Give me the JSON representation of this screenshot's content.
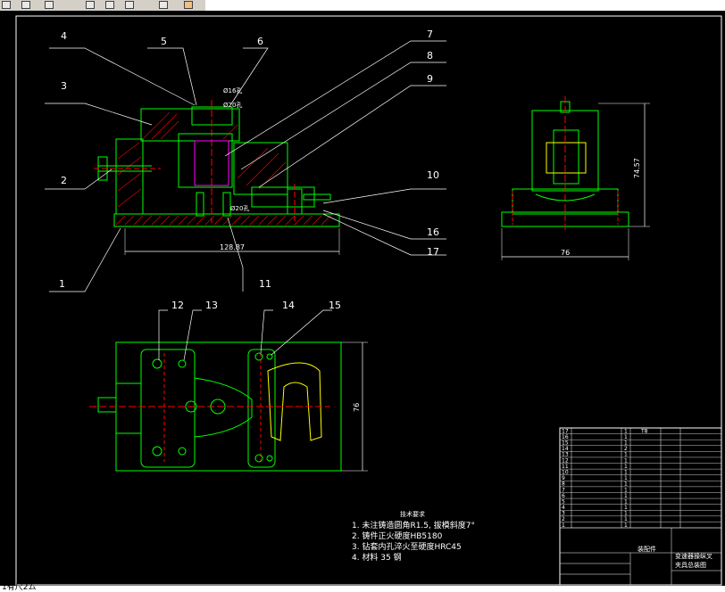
{
  "toolbar": {
    "icons": [
      "new-file-icon",
      "open-folder-icon",
      "pencil-icon",
      "save-icon",
      "print-icon",
      "star-icon",
      "pin-icon",
      "paint-icon"
    ]
  },
  "status_text": "1有尺2ム",
  "balloons": [
    "1",
    "2",
    "3",
    "4",
    "5",
    "6",
    "7",
    "8",
    "9",
    "10",
    "11",
    "12",
    "13",
    "14",
    "15",
    "16",
    "17"
  ],
  "dimensions": {
    "hole_top_a": "Ø16孔",
    "hole_top_b": "Ø20孔",
    "hole_bottom": "Ø20孔",
    "front_width": "128.87",
    "side_height": "74.57",
    "side_width": "76",
    "plan_height": "76"
  },
  "tech_notes": {
    "title": "技术要求",
    "items": [
      "1. 未注铸造圆角R1.5, 拔模斜度7°",
      "2. 铸件正火硬度HB5180",
      "3. 钻套内孔淬火至硬度HRC45",
      "4. 材料 35 钢"
    ]
  },
  "title_block": {
    "assembly_label": "装配件",
    "drawing_title_1": "变速器操纵叉",
    "drawing_title_2": "夹具总装图",
    "part_rows": [
      {
        "no": "17",
        "code": "",
        "qty": "1",
        "mat": "T8",
        "std": ""
      },
      {
        "no": "16",
        "code": "",
        "qty": "1",
        "mat": "",
        "std": ""
      },
      {
        "no": "15",
        "code": "",
        "qty": "1",
        "mat": "",
        "std": ""
      },
      {
        "no": "14",
        "code": "",
        "qty": "2",
        "mat": "",
        "std": ""
      },
      {
        "no": "13",
        "code": "",
        "qty": "1",
        "mat": "",
        "std": ""
      },
      {
        "no": "12",
        "code": "",
        "qty": "1",
        "mat": "",
        "std": ""
      },
      {
        "no": "11",
        "code": "",
        "qty": "1",
        "mat": "",
        "std": ""
      },
      {
        "no": "10",
        "code": "",
        "qty": "1",
        "mat": "",
        "std": ""
      },
      {
        "no": "9",
        "code": "",
        "qty": "1",
        "mat": "",
        "std": ""
      },
      {
        "no": "8",
        "code": "",
        "qty": "1",
        "mat": "",
        "std": ""
      },
      {
        "no": "7",
        "code": "",
        "qty": "1",
        "mat": "",
        "std": ""
      },
      {
        "no": "6",
        "code": "",
        "qty": "1",
        "mat": "",
        "std": ""
      },
      {
        "no": "5",
        "code": "",
        "qty": "1",
        "mat": "",
        "std": ""
      },
      {
        "no": "4",
        "code": "",
        "qty": "1",
        "mat": "",
        "std": ""
      },
      {
        "no": "3",
        "code": "",
        "qty": "1",
        "mat": "",
        "std": ""
      },
      {
        "no": "2",
        "code": "",
        "qty": "1",
        "mat": "",
        "std": ""
      },
      {
        "no": "1",
        "code": "",
        "qty": "1",
        "mat": "",
        "std": ""
      }
    ]
  },
  "colors": {
    "background": "#000000",
    "outline": "#00ff00",
    "dimension": "#ffffff",
    "centerline": "#ff0000",
    "hatch": "#ff0000",
    "workpiece": "#ffff00",
    "detail": "#ff00ff",
    "frame": "#ffffff"
  }
}
